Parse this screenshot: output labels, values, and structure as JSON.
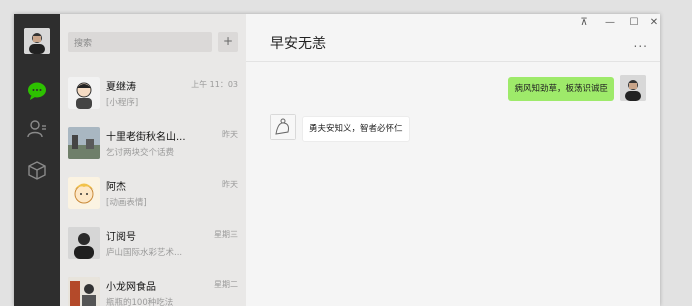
{
  "search": {
    "placeholder": "搜索"
  },
  "add_button": {
    "label": "+"
  },
  "conversations": [
    {
      "name": "夏继涛",
      "time": "上午 11：03",
      "preview": "[小程序]"
    },
    {
      "name": "十里老街秋名山...",
      "time": "昨天",
      "preview": "乞讨两块交个话费"
    },
    {
      "name": "阿杰",
      "time": "昨天",
      "preview": "[动画表情]"
    },
    {
      "name": "订阅号",
      "time": "星期三",
      "preview": "庐山国际水彩艺术..."
    },
    {
      "name": "小龙网食品",
      "time": "星期二",
      "preview": "瓶瓶的100种吃法"
    }
  ],
  "chat": {
    "title": "早安无恙",
    "more": "...",
    "messages": [
      {
        "from": "me",
        "text": "病风知劲草，板荡识诚臣"
      },
      {
        "from": "them",
        "text": "勇夫安知义，智者必怀仁"
      }
    ]
  },
  "window_controls": {
    "pin": "⊼",
    "minimize": "—",
    "maximize": "☐",
    "close": "✕"
  },
  "colors": {
    "sidebar": "#2e2e2e",
    "accent_green": "#2dc100",
    "bubble_me": "#9eea6a"
  }
}
